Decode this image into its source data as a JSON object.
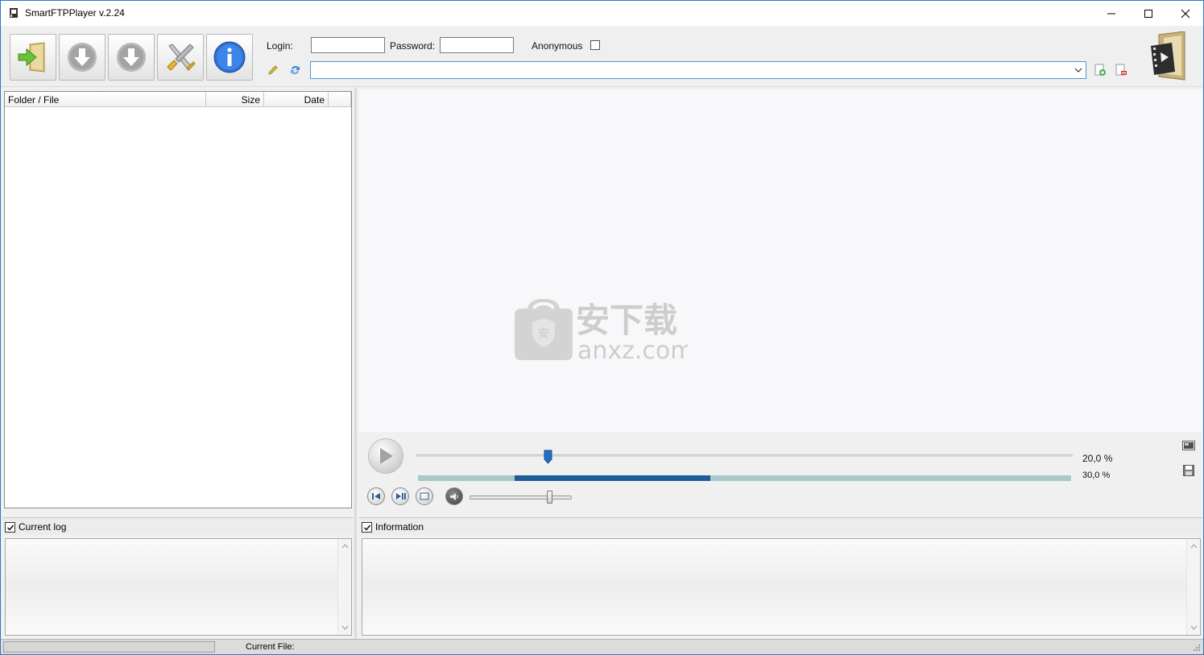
{
  "window": {
    "title": "SmartFTPPlayer v.2.24",
    "controls": {
      "minimize": "minimize-icon",
      "maximize": "maximize-icon",
      "close": "close-icon"
    }
  },
  "toolbar": {
    "buttons": [
      {
        "name": "open-folder",
        "icon": "folder-enter-icon"
      },
      {
        "name": "download-1",
        "icon": "download-arrow-icon"
      },
      {
        "name": "download-2",
        "icon": "download-arrow-icon"
      },
      {
        "name": "settings",
        "icon": "tools-icon"
      },
      {
        "name": "about",
        "icon": "info-icon"
      }
    ],
    "login_label": "Login:",
    "login_value": "",
    "password_label": "Password:",
    "password_value": "",
    "anonymous_label": "Anonymous",
    "anonymous_checked": false,
    "url_value": "",
    "icons": [
      "edit-pencil-icon",
      "refresh-icon",
      "add-bookmark-icon",
      "remove-bookmark-icon",
      "film-reel-logo"
    ]
  },
  "file_list": {
    "columns": [
      "Folder / File",
      "Size",
      "Date"
    ],
    "rows": []
  },
  "player": {
    "seek_percent_label": "20,0 %",
    "seek_fraction": 0.2,
    "buffer_percent_label": "30,0 %",
    "buffer_fraction": 0.3,
    "volume_fraction": 0.78,
    "buttons": [
      "play-icon",
      "previous-icon",
      "play-pause-icon",
      "stop-icon",
      "volume-icon"
    ],
    "side_icons": [
      "screenshot-icon",
      "save-icon"
    ]
  },
  "watermark": {
    "chinese_text": "安下载",
    "domain_text": "anxz.com"
  },
  "log_panel": {
    "label": "Current log",
    "checked": true
  },
  "info_panel": {
    "label": "Information",
    "checked": true
  },
  "statusbar": {
    "current_file_label": "Current File:"
  },
  "colors": {
    "accent": "#2b78c2",
    "seek_thumb": "#1f6fc4",
    "buffer_fill": "#1f5d99",
    "buffer_bg": "#a9c8c8"
  }
}
